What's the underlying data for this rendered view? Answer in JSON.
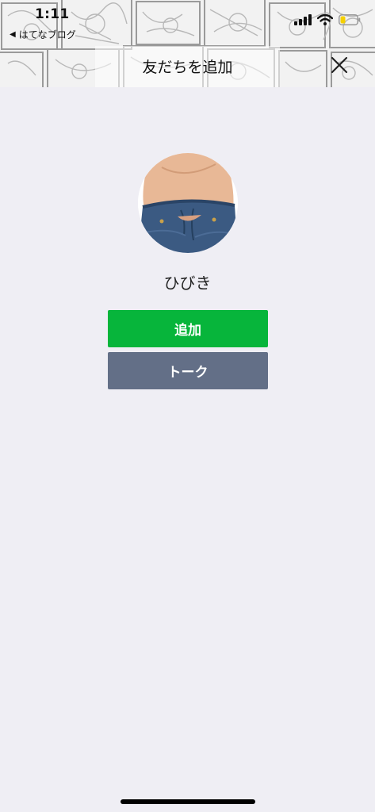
{
  "status_bar": {
    "time": "1:11",
    "back_app": "はてなブログ",
    "back_glyph": "◀",
    "icons": [
      "signal-icon",
      "wifi-icon",
      "battery-icon"
    ],
    "battery_level": 0.3
  },
  "header": {
    "title": "友だちを追加",
    "close_icon": "close-icon"
  },
  "profile": {
    "name": "ひびき"
  },
  "actions": {
    "add_label": "追加",
    "talk_label": "トーク"
  },
  "colors": {
    "background": "#efeef4",
    "add_button": "#07b53b",
    "talk_button": "#636f87",
    "battery_fill": "#f5d000"
  }
}
